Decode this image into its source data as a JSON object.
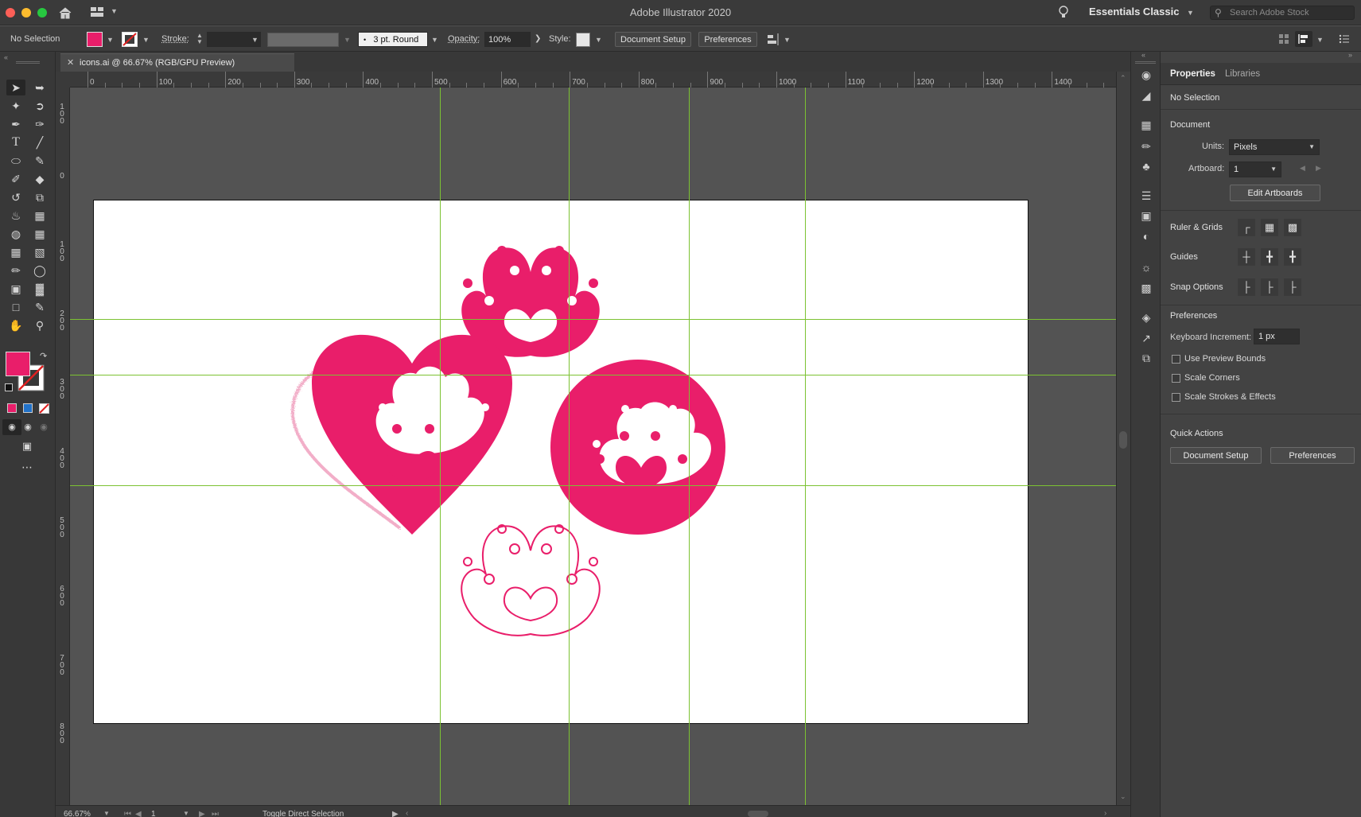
{
  "app": {
    "title": "Adobe Illustrator 2020",
    "workspace": "Essentials Classic",
    "search_placeholder": "Search Adobe Stock"
  },
  "colors": {
    "accent_pink": "#e91e6a",
    "guide_green": "#7cc232",
    "artboard": "#ffffff",
    "pasteboard": "#535353"
  },
  "control_bar": {
    "selection": "No Selection",
    "stroke_label": "Stroke:",
    "brush_value": "3 pt. Round",
    "opacity_label": "Opacity:",
    "opacity_value": "100%",
    "style_label": "Style:",
    "document_setup": "Document Setup",
    "preferences": "Preferences"
  },
  "document_tab": {
    "label": "icons.ai @ 66.67% (RGB/GPU Preview)"
  },
  "ruler": {
    "h_labels": [
      "0",
      "100",
      "200",
      "300",
      "400",
      "500",
      "600",
      "700",
      "800",
      "900",
      "1000",
      "1100",
      "1200",
      "1300",
      "1400"
    ],
    "v_labels": [
      "1\n0\n0",
      "0",
      "1\n0\n0",
      "2\n0\n0",
      "3\n0\n0",
      "4\n0\n0",
      "5\n0\n0",
      "6\n0\n0",
      "7\n0\n0",
      "8\n0\n0"
    ]
  },
  "status_bar": {
    "zoom": "66.67%",
    "artboard_number": "1",
    "tool_hint": "Toggle Direct Selection"
  },
  "panel": {
    "tabs": [
      "Properties",
      "Libraries"
    ],
    "selection": "No Selection",
    "document_heading": "Document",
    "units_label": "Units:",
    "units_value": "Pixels",
    "artboard_label": "Artboard:",
    "artboard_value": "1",
    "edit_artboards": "Edit Artboards",
    "ruler_grids": "Ruler & Grids",
    "guides": "Guides",
    "snap_options": "Snap Options",
    "preferences_heading": "Preferences",
    "keyboard_increment_label": "Keyboard Increment:",
    "keyboard_increment_value": "1 px",
    "use_preview_bounds": "Use Preview Bounds",
    "scale_corners": "Scale Corners",
    "scale_strokes": "Scale Strokes & Effects",
    "quick_actions": "Quick Actions",
    "qa_document_setup": "Document Setup",
    "qa_preferences": "Preferences"
  }
}
